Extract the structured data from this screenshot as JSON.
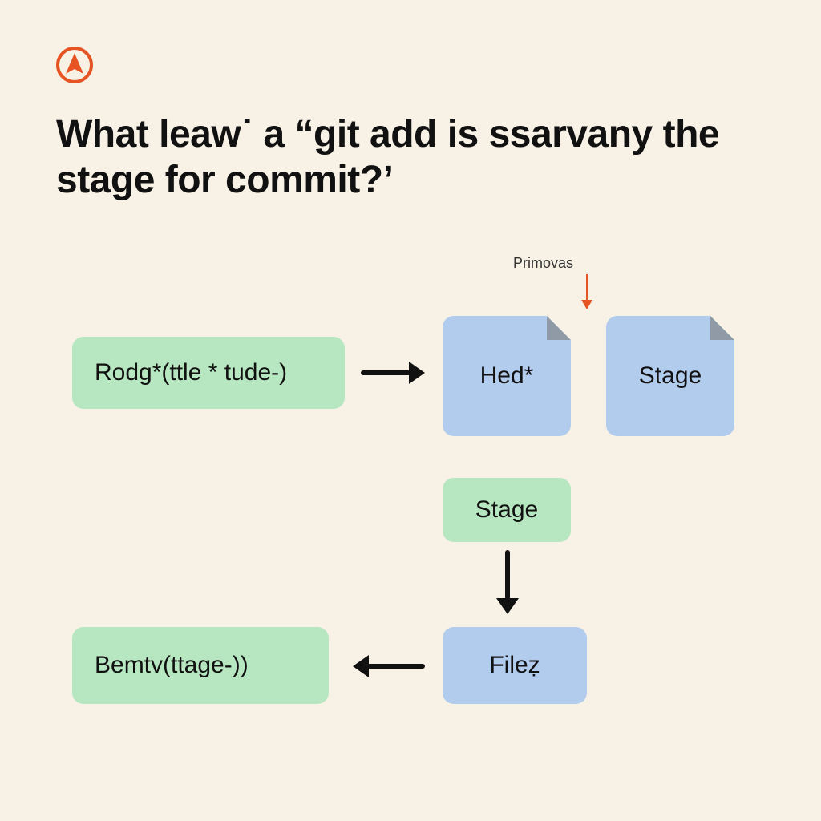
{
  "title": "What leaw˙ a “git add is ssarvany the stage for commit?’",
  "annotation": {
    "label": "Primovas"
  },
  "nodes": {
    "rodg": {
      "label": "Rodg*(ttle * tude-)"
    },
    "hed": {
      "label": "Hed*"
    },
    "stage_file": {
      "label": "Stage"
    },
    "stage_box": {
      "label": "Stage"
    },
    "filez": {
      "label": "Fileẓ"
    },
    "bemtv": {
      "label": "Bemtv(ttage-))"
    }
  },
  "colors": {
    "background": "#f7f1e6",
    "green": "#b7e7c0",
    "blue": "#b2cced",
    "accent": "#e75423",
    "text": "#111111"
  }
}
